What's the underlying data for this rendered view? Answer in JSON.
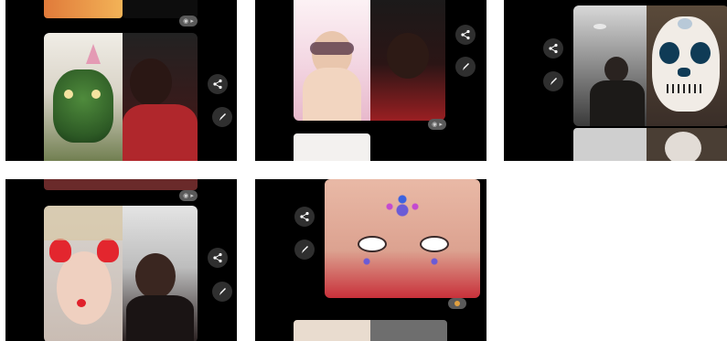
{
  "thumbnails": [
    {
      "id": "thumb-1",
      "actions": [
        "share-icon",
        "edit-icon"
      ]
    },
    {
      "id": "thumb-2",
      "actions": [
        "share-icon",
        "edit-icon"
      ]
    },
    {
      "id": "thumb-3",
      "actions": [
        "share-icon",
        "edit-icon"
      ]
    },
    {
      "id": "thumb-4",
      "actions": [
        "share-icon",
        "edit-icon"
      ]
    },
    {
      "id": "thumb-5",
      "actions": [
        "share-icon",
        "edit-icon"
      ]
    }
  ],
  "colors": {
    "background": "#ffffff",
    "tile": "#000000",
    "button": "#2f2f2f",
    "badge": "#5a5a5a",
    "accent_emoji": "#e0a040"
  }
}
